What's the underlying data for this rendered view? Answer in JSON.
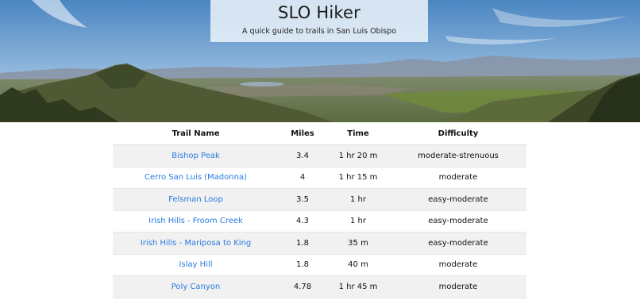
{
  "header": {
    "title": "SLO Hiker",
    "subtitle": "A quick guide to trails in San Luis Obispo"
  },
  "table": {
    "columns": [
      "Trail Name",
      "Miles",
      "Time",
      "Difficulty"
    ],
    "rows": [
      {
        "name": "Bishop Peak",
        "miles": "3.4",
        "time": "1 hr 20 m",
        "difficulty": "moderate-strenuous"
      },
      {
        "name": "Cerro San Luis (Madonna)",
        "miles": "4",
        "time": "1 hr 15 m",
        "difficulty": "moderate"
      },
      {
        "name": "Felsman Loop",
        "miles": "3.5",
        "time": "1 hr",
        "difficulty": "easy-moderate"
      },
      {
        "name": "Irish Hills - Froom Creek",
        "miles": "4.3",
        "time": "1 hr",
        "difficulty": "easy-moderate"
      },
      {
        "name": "Irish Hills - Mariposa to King",
        "miles": "1.8",
        "time": "35 m",
        "difficulty": "easy-moderate"
      },
      {
        "name": "Islay Hill",
        "miles": "1.8",
        "time": "40 m",
        "difficulty": "moderate"
      },
      {
        "name": "Poly Canyon",
        "miles": "4.78",
        "time": "1 hr 45 m",
        "difficulty": "moderate"
      }
    ]
  },
  "colors": {
    "link": "#2a7ae2",
    "stripe": "#f1f1f1"
  }
}
